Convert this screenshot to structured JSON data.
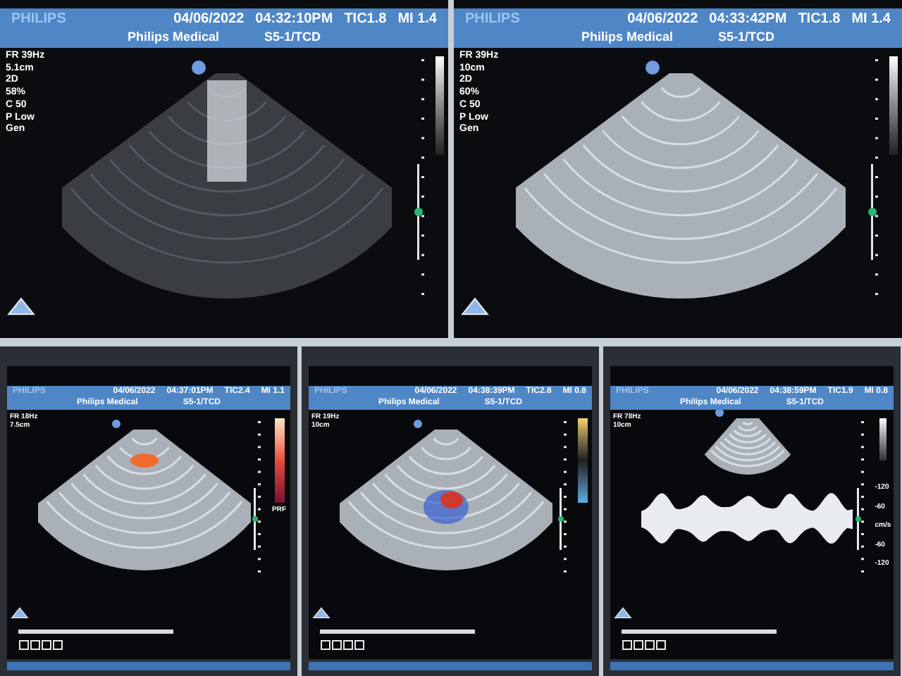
{
  "top_row": [
    {
      "kind": "bmode",
      "brand": "PHILIPS",
      "date": "04/06/2022",
      "time": "04:32:10PM",
      "tic": "TIC1.8",
      "mi": "MI 1.4",
      "site": "Philips Medical",
      "probe": "S5-1/TCD",
      "params": [
        "FR 39Hz",
        "5.1cm",
        "2D",
        "58%",
        "C 50",
        "P Low",
        "Gen"
      ]
    },
    {
      "kind": "bmode",
      "brand": "PHILIPS",
      "date": "04/06/2022",
      "time": "04:33:42PM",
      "tic": "TIC1.8",
      "mi": "MI 1.4",
      "site": "Philips Medical",
      "probe": "S5-1/TCD",
      "params": [
        "FR 39Hz",
        "10cm",
        "2D",
        "60%",
        "C 50",
        "P Low",
        "Gen"
      ]
    }
  ],
  "bottom_row": [
    {
      "kind": "power",
      "brand": "PHILIPS",
      "date": "04/06/2022",
      "time": "04:37:01PM",
      "tic": "TIC2.4",
      "mi": "MI 1.1",
      "site": "Philips Medical",
      "probe": "S5-1/TCD",
      "params": [
        "FR 18Hz",
        "7.5cm"
      ],
      "scale_label": "PRF"
    },
    {
      "kind": "color",
      "brand": "PHILIPS",
      "date": "04/06/2022",
      "time": "04:38:39PM",
      "tic": "TIC2.8",
      "mi": "MI 0.8",
      "site": "Philips Medical",
      "probe": "S5-1/TCD",
      "params": [
        "FR 19Hz",
        "10cm"
      ]
    },
    {
      "kind": "doppler",
      "brand": "PHILIPS",
      "date": "04/06/2022",
      "time": "04:38:59PM",
      "tic": "TIC1.9",
      "mi": "MI 0.8",
      "site": "Philips Medical",
      "probe": "S5-1/TCD",
      "params": [
        "FR 78Hz",
        "10cm"
      ],
      "axis": [
        "-120",
        "-60",
        "cm/s",
        "-60",
        "-120"
      ]
    }
  ]
}
